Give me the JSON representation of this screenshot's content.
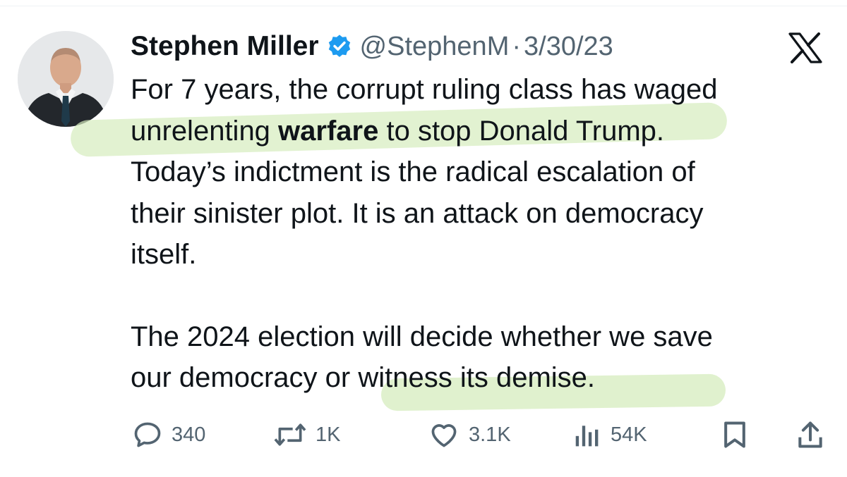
{
  "author": {
    "name": "Stephen Miller",
    "handle": "@StephenM",
    "separator": "·",
    "date": "3/30/23",
    "verified": true,
    "avatar_icon": "avatar-photo"
  },
  "platform_icon": "x-logo-icon",
  "tweet": {
    "paragraph1": {
      "line1": "For 7 years, the corrupt ruling class has waged",
      "line2_a": "unrelenting ",
      "line2_bold": "warfare",
      "line2_b": " to stop Donald Trump.",
      "line3": "Today’s indictment is the radical escalation of",
      "line4": "their sinister plot. It is an attack on democracy",
      "line5": "itself."
    },
    "paragraph2": {
      "line1": "The 2024 election will decide whether we save",
      "line2": "our democracy or witness its demise."
    }
  },
  "actions": {
    "replies": "340",
    "reposts": "1K",
    "likes": "3.1K",
    "views": "54K"
  },
  "colors": {
    "text": "#0f1419",
    "secondary": "#536471",
    "verified": "#1d9bf0",
    "highlight": "#d6ecbd"
  }
}
